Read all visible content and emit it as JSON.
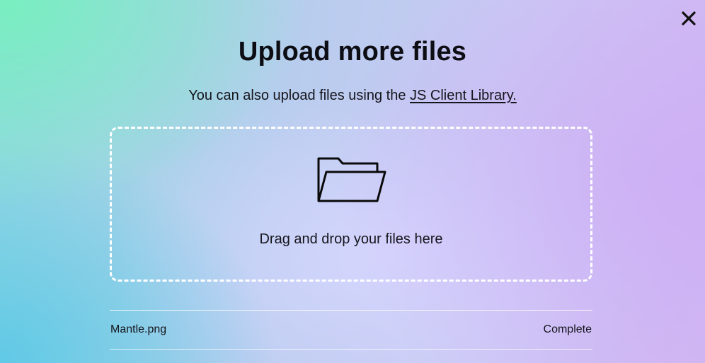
{
  "dialog": {
    "close_icon": "close-icon",
    "title": "Upload more files",
    "subtitle_prefix": "You can also upload files using the ",
    "subtitle_link": "JS Client Library."
  },
  "dropzone": {
    "icon": "folder-open-icon",
    "label": "Drag and drop your files here"
  },
  "files": [
    {
      "name": "Mantle.png",
      "status": "Complete"
    }
  ]
}
